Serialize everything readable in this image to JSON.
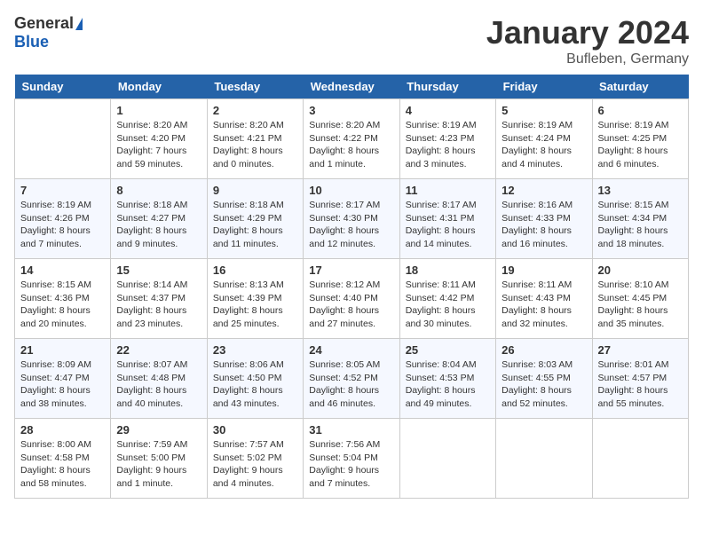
{
  "header": {
    "logo_general": "General",
    "logo_blue": "Blue",
    "month_title": "January 2024",
    "location": "Bufleben, Germany"
  },
  "days_of_week": [
    "Sunday",
    "Monday",
    "Tuesday",
    "Wednesday",
    "Thursday",
    "Friday",
    "Saturday"
  ],
  "weeks": [
    [
      {
        "day": "",
        "sunrise": "",
        "sunset": "",
        "daylight": ""
      },
      {
        "day": "1",
        "sunrise": "Sunrise: 8:20 AM",
        "sunset": "Sunset: 4:20 PM",
        "daylight": "Daylight: 7 hours and 59 minutes."
      },
      {
        "day": "2",
        "sunrise": "Sunrise: 8:20 AM",
        "sunset": "Sunset: 4:21 PM",
        "daylight": "Daylight: 8 hours and 0 minutes."
      },
      {
        "day": "3",
        "sunrise": "Sunrise: 8:20 AM",
        "sunset": "Sunset: 4:22 PM",
        "daylight": "Daylight: 8 hours and 1 minute."
      },
      {
        "day": "4",
        "sunrise": "Sunrise: 8:19 AM",
        "sunset": "Sunset: 4:23 PM",
        "daylight": "Daylight: 8 hours and 3 minutes."
      },
      {
        "day": "5",
        "sunrise": "Sunrise: 8:19 AM",
        "sunset": "Sunset: 4:24 PM",
        "daylight": "Daylight: 8 hours and 4 minutes."
      },
      {
        "day": "6",
        "sunrise": "Sunrise: 8:19 AM",
        "sunset": "Sunset: 4:25 PM",
        "daylight": "Daylight: 8 hours and 6 minutes."
      }
    ],
    [
      {
        "day": "7",
        "sunrise": "Sunrise: 8:19 AM",
        "sunset": "Sunset: 4:26 PM",
        "daylight": "Daylight: 8 hours and 7 minutes."
      },
      {
        "day": "8",
        "sunrise": "Sunrise: 8:18 AM",
        "sunset": "Sunset: 4:27 PM",
        "daylight": "Daylight: 8 hours and 9 minutes."
      },
      {
        "day": "9",
        "sunrise": "Sunrise: 8:18 AM",
        "sunset": "Sunset: 4:29 PM",
        "daylight": "Daylight: 8 hours and 11 minutes."
      },
      {
        "day": "10",
        "sunrise": "Sunrise: 8:17 AM",
        "sunset": "Sunset: 4:30 PM",
        "daylight": "Daylight: 8 hours and 12 minutes."
      },
      {
        "day": "11",
        "sunrise": "Sunrise: 8:17 AM",
        "sunset": "Sunset: 4:31 PM",
        "daylight": "Daylight: 8 hours and 14 minutes."
      },
      {
        "day": "12",
        "sunrise": "Sunrise: 8:16 AM",
        "sunset": "Sunset: 4:33 PM",
        "daylight": "Daylight: 8 hours and 16 minutes."
      },
      {
        "day": "13",
        "sunrise": "Sunrise: 8:15 AM",
        "sunset": "Sunset: 4:34 PM",
        "daylight": "Daylight: 8 hours and 18 minutes."
      }
    ],
    [
      {
        "day": "14",
        "sunrise": "Sunrise: 8:15 AM",
        "sunset": "Sunset: 4:36 PM",
        "daylight": "Daylight: 8 hours and 20 minutes."
      },
      {
        "day": "15",
        "sunrise": "Sunrise: 8:14 AM",
        "sunset": "Sunset: 4:37 PM",
        "daylight": "Daylight: 8 hours and 23 minutes."
      },
      {
        "day": "16",
        "sunrise": "Sunrise: 8:13 AM",
        "sunset": "Sunset: 4:39 PM",
        "daylight": "Daylight: 8 hours and 25 minutes."
      },
      {
        "day": "17",
        "sunrise": "Sunrise: 8:12 AM",
        "sunset": "Sunset: 4:40 PM",
        "daylight": "Daylight: 8 hours and 27 minutes."
      },
      {
        "day": "18",
        "sunrise": "Sunrise: 8:11 AM",
        "sunset": "Sunset: 4:42 PM",
        "daylight": "Daylight: 8 hours and 30 minutes."
      },
      {
        "day": "19",
        "sunrise": "Sunrise: 8:11 AM",
        "sunset": "Sunset: 4:43 PM",
        "daylight": "Daylight: 8 hours and 32 minutes."
      },
      {
        "day": "20",
        "sunrise": "Sunrise: 8:10 AM",
        "sunset": "Sunset: 4:45 PM",
        "daylight": "Daylight: 8 hours and 35 minutes."
      }
    ],
    [
      {
        "day": "21",
        "sunrise": "Sunrise: 8:09 AM",
        "sunset": "Sunset: 4:47 PM",
        "daylight": "Daylight: 8 hours and 38 minutes."
      },
      {
        "day": "22",
        "sunrise": "Sunrise: 8:07 AM",
        "sunset": "Sunset: 4:48 PM",
        "daylight": "Daylight: 8 hours and 40 minutes."
      },
      {
        "day": "23",
        "sunrise": "Sunrise: 8:06 AM",
        "sunset": "Sunset: 4:50 PM",
        "daylight": "Daylight: 8 hours and 43 minutes."
      },
      {
        "day": "24",
        "sunrise": "Sunrise: 8:05 AM",
        "sunset": "Sunset: 4:52 PM",
        "daylight": "Daylight: 8 hours and 46 minutes."
      },
      {
        "day": "25",
        "sunrise": "Sunrise: 8:04 AM",
        "sunset": "Sunset: 4:53 PM",
        "daylight": "Daylight: 8 hours and 49 minutes."
      },
      {
        "day": "26",
        "sunrise": "Sunrise: 8:03 AM",
        "sunset": "Sunset: 4:55 PM",
        "daylight": "Daylight: 8 hours and 52 minutes."
      },
      {
        "day": "27",
        "sunrise": "Sunrise: 8:01 AM",
        "sunset": "Sunset: 4:57 PM",
        "daylight": "Daylight: 8 hours and 55 minutes."
      }
    ],
    [
      {
        "day": "28",
        "sunrise": "Sunrise: 8:00 AM",
        "sunset": "Sunset: 4:58 PM",
        "daylight": "Daylight: 8 hours and 58 minutes."
      },
      {
        "day": "29",
        "sunrise": "Sunrise: 7:59 AM",
        "sunset": "Sunset: 5:00 PM",
        "daylight": "Daylight: 9 hours and 1 minute."
      },
      {
        "day": "30",
        "sunrise": "Sunrise: 7:57 AM",
        "sunset": "Sunset: 5:02 PM",
        "daylight": "Daylight: 9 hours and 4 minutes."
      },
      {
        "day": "31",
        "sunrise": "Sunrise: 7:56 AM",
        "sunset": "Sunset: 5:04 PM",
        "daylight": "Daylight: 9 hours and 7 minutes."
      },
      {
        "day": "",
        "sunrise": "",
        "sunset": "",
        "daylight": ""
      },
      {
        "day": "",
        "sunrise": "",
        "sunset": "",
        "daylight": ""
      },
      {
        "day": "",
        "sunrise": "",
        "sunset": "",
        "daylight": ""
      }
    ]
  ]
}
